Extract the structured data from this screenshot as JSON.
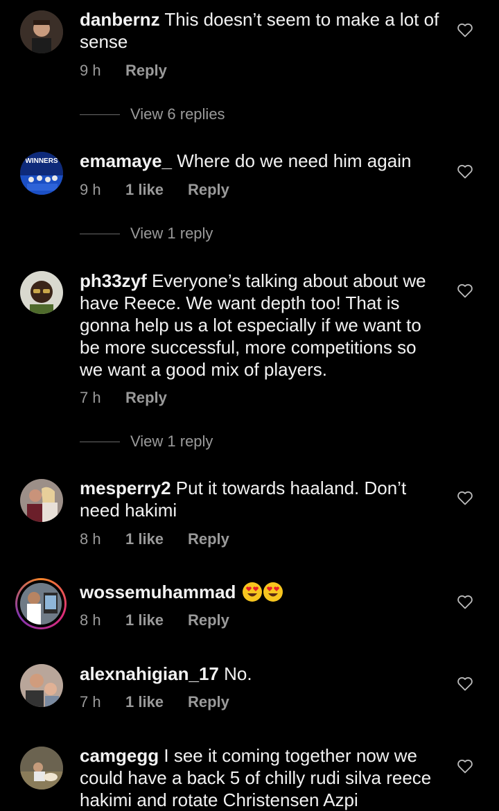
{
  "icons": {
    "like": "heart-outline-icon"
  },
  "comments": [
    {
      "username": "danbernz",
      "text": " This doesn’t seem to make a lot of sense",
      "time": "9 h",
      "likes": "",
      "reply_label": "Reply",
      "view_replies": "View 6 replies"
    },
    {
      "username": "emamaye_",
      "text": " Where do we need him again",
      "time": "9 h",
      "likes": "1 like",
      "reply_label": "Reply",
      "view_replies": "View 1 reply"
    },
    {
      "username": "ph33zyf",
      "text": " Everyone’s talking about about we have Reece. We want depth too! That is gonna help us a lot especially if we want to be more successful, more competitions so we want a good mix of players.",
      "time": "7 h",
      "likes": "",
      "reply_label": "Reply",
      "view_replies": "View 1 reply"
    },
    {
      "username": "mesperry2",
      "text": " Put it towards haaland.  Don’t need hakimi",
      "time": "8 h",
      "likes": "1 like",
      "reply_label": "Reply",
      "view_replies": ""
    },
    {
      "username": "wossemuhammad",
      "text": " ",
      "emoji": "heart-eyes-emoji x2",
      "time": "8 h",
      "likes": "1 like",
      "reply_label": "Reply",
      "view_replies": ""
    },
    {
      "username": "alexnahigian_17",
      "text": " No.",
      "time": "7 h",
      "likes": "1 like",
      "reply_label": "Reply",
      "view_replies": ""
    },
    {
      "username": "camgegg",
      "text": " I see it coming together now we could have a back 5 of chilly rudi silva reece hakimi and rotate Christensen Azpi",
      "time": "",
      "likes": "",
      "reply_label": "",
      "view_replies": ""
    }
  ],
  "avatar_badge_text": "WINNERS"
}
